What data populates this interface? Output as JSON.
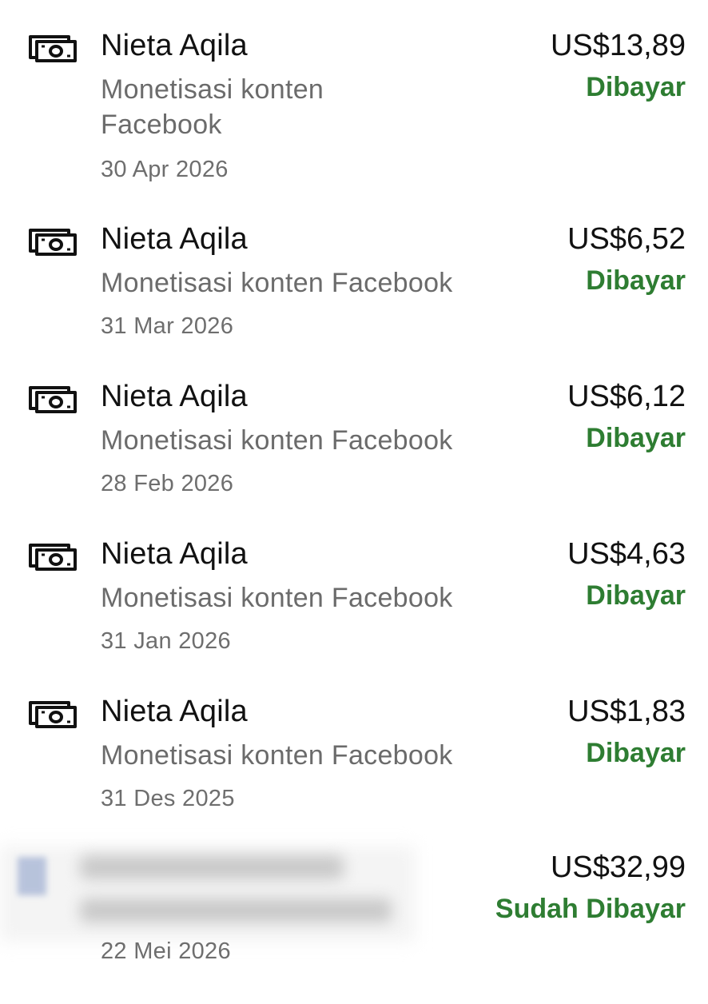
{
  "payments": [
    {
      "icon": "money-bill-icon",
      "name": "Nieta Aqila",
      "description": "Monetisasi konten Facebook",
      "date": "30 Apr 2026",
      "amount": "US$13,89",
      "status": "Dibayar"
    },
    {
      "icon": "money-bill-icon",
      "name": "Nieta Aqila",
      "description": "Monetisasi konten Facebook",
      "date": "31 Mar 2026",
      "amount": "US$6,52",
      "status": "Dibayar"
    },
    {
      "icon": "money-bill-icon",
      "name": "Nieta Aqila",
      "description": "Monetisasi konten Facebook",
      "date": "28 Feb 2026",
      "amount": "US$6,12",
      "status": "Dibayar"
    },
    {
      "icon": "money-bill-icon",
      "name": "Nieta Aqila",
      "description": "Monetisasi konten Facebook",
      "date": "31 Jan 2026",
      "amount": "US$4,63",
      "status": "Dibayar"
    },
    {
      "icon": "money-bill-icon",
      "name": "Nieta Aqila",
      "description": "Monetisasi konten Facebook",
      "date": "31 Des 2025",
      "amount": "US$1,83",
      "status": "Dibayar"
    },
    {
      "icon": "blurred-avatar",
      "name": "",
      "description": "",
      "date": "22 Mei 2026",
      "amount": "US$32,99",
      "status": "Sudah Dibayar"
    }
  ],
  "colors": {
    "status_paid": "#2e7d32",
    "primary_text": "#111111",
    "secondary_text": "#6b6b6b"
  }
}
